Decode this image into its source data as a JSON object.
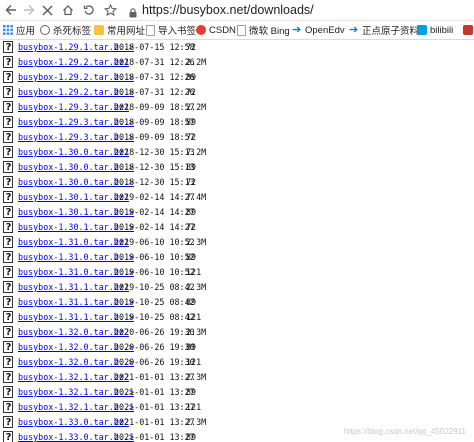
{
  "browser": {
    "url": "https://busybox.net/downloads/"
  },
  "bookmarks": [
    {
      "label": "应用",
      "icon": "apps-icon",
      "color": "#4285f4"
    },
    {
      "label": "杀死标签",
      "icon": "globe-icon",
      "color": "#5f6368"
    },
    {
      "label": "常用网址",
      "icon": "folder-icon",
      "color": "#f5c242"
    },
    {
      "label": "导入书签",
      "icon": "document-icon",
      "color": "#5f6368"
    },
    {
      "label": "CSDN",
      "icon": "csdn-logo-icon",
      "color": "#e33e33"
    },
    {
      "label": "微软 Bing",
      "icon": "document-icon",
      "color": "#5f6368"
    },
    {
      "label": "OpenEdv",
      "icon": "arrow-icon",
      "color": "#1a73e8"
    },
    {
      "label": "正点原子资料",
      "icon": "arrow-icon",
      "color": "#1a73e8"
    },
    {
      "label": "bilibili",
      "icon": "bilibili-icon",
      "color": "#00a1d6"
    },
    {
      "label": "",
      "icon": "bookmark-icon",
      "color": "#c0392b"
    }
  ],
  "files": [
    {
      "name": "busybox-1.29.1.tar.b..>",
      "date": "2018-07-15 12:58",
      "size": "72"
    },
    {
      "name": "busybox-1.29.2.tar.bz2",
      "date": "2018-07-31 12:26",
      "size": "2.2M"
    },
    {
      "name": "busybox-1.29.2.tar.b..>",
      "date": "2018-07-31 12:26",
      "size": "89"
    },
    {
      "name": "busybox-1.29.2.tar.b..>",
      "date": "2018-07-31 12:26",
      "size": "72"
    },
    {
      "name": "busybox-1.29.3.tar.bz2",
      "date": "2018-09-09 18:57",
      "size": "2.2M"
    },
    {
      "name": "busybox-1.29.3.tar.b..>",
      "date": "2018-09-09 18:57",
      "size": "89"
    },
    {
      "name": "busybox-1.29.3.tar.b..>",
      "date": "2018-09-09 18:57",
      "size": "72"
    },
    {
      "name": "busybox-1.30.0.tar.bz2",
      "date": "2018-12-30 15:13",
      "size": "7.2M"
    },
    {
      "name": "busybox-1.30.0.tar.b..>",
      "date": "2018-12-30 15:13",
      "size": "89"
    },
    {
      "name": "busybox-1.30.0.tar.b..>",
      "date": "2018-12-30 15:13",
      "size": "72"
    },
    {
      "name": "busybox-1.30.1.tar.bz2",
      "date": "2019-02-14 14:27",
      "size": "7.4M"
    },
    {
      "name": "busybox-1.30.1.tar.b..>",
      "date": "2019-02-14 14:27",
      "size": "89"
    },
    {
      "name": "busybox-1.30.1.tar.b..>",
      "date": "2019-02-14 14:27",
      "size": "72"
    },
    {
      "name": "busybox-1.31.0.tar.bz2",
      "date": "2019-06-10 10:52",
      "size": "2.3M"
    },
    {
      "name": "busybox-1.31.0.tar.b..>",
      "date": "2019-06-10 10:52",
      "size": "89"
    },
    {
      "name": "busybox-1.31.0.tar.b..>",
      "date": "2019-06-10 10:52",
      "size": "121"
    },
    {
      "name": "busybox-1.31.1.tar.bz2",
      "date": "2019-10-25 08:42",
      "size": "2.3M"
    },
    {
      "name": "busybox-1.31.1.tar.b..>",
      "date": "2019-10-25 08:42",
      "size": "89"
    },
    {
      "name": "busybox-1.31.1.tar.b..>",
      "date": "2019-10-25 08:42",
      "size": "121"
    },
    {
      "name": "busybox-1.32.0.tar.bz2",
      "date": "2020-06-26 19:30",
      "size": "2.3M"
    },
    {
      "name": "busybox-1.32.0.tar.b..>",
      "date": "2020-06-26 19:30",
      "size": "89"
    },
    {
      "name": "busybox-1.32.0.tar.b..>",
      "date": "2020-06-26 19:30",
      "size": "121"
    },
    {
      "name": "busybox-1.32.1.tar.bz2",
      "date": "2021-01-01 13:27",
      "size": "2.3M"
    },
    {
      "name": "busybox-1.32.1.tar.b..>",
      "date": "2021-01-01 13:27",
      "size": "89"
    },
    {
      "name": "busybox-1.32.1.tar.b..>",
      "date": "2021-01-01 13:27",
      "size": "121"
    },
    {
      "name": "busybox-1.33.0.tar.bz2",
      "date": "2021-01-01 13:27",
      "size": "2.3M"
    },
    {
      "name": "busybox-1.33.0.tar.b..>",
      "date": "2021-01-01 13:27",
      "size": "89"
    }
  ],
  "watermark": "https://blog.csdn.net/qq_45022911"
}
